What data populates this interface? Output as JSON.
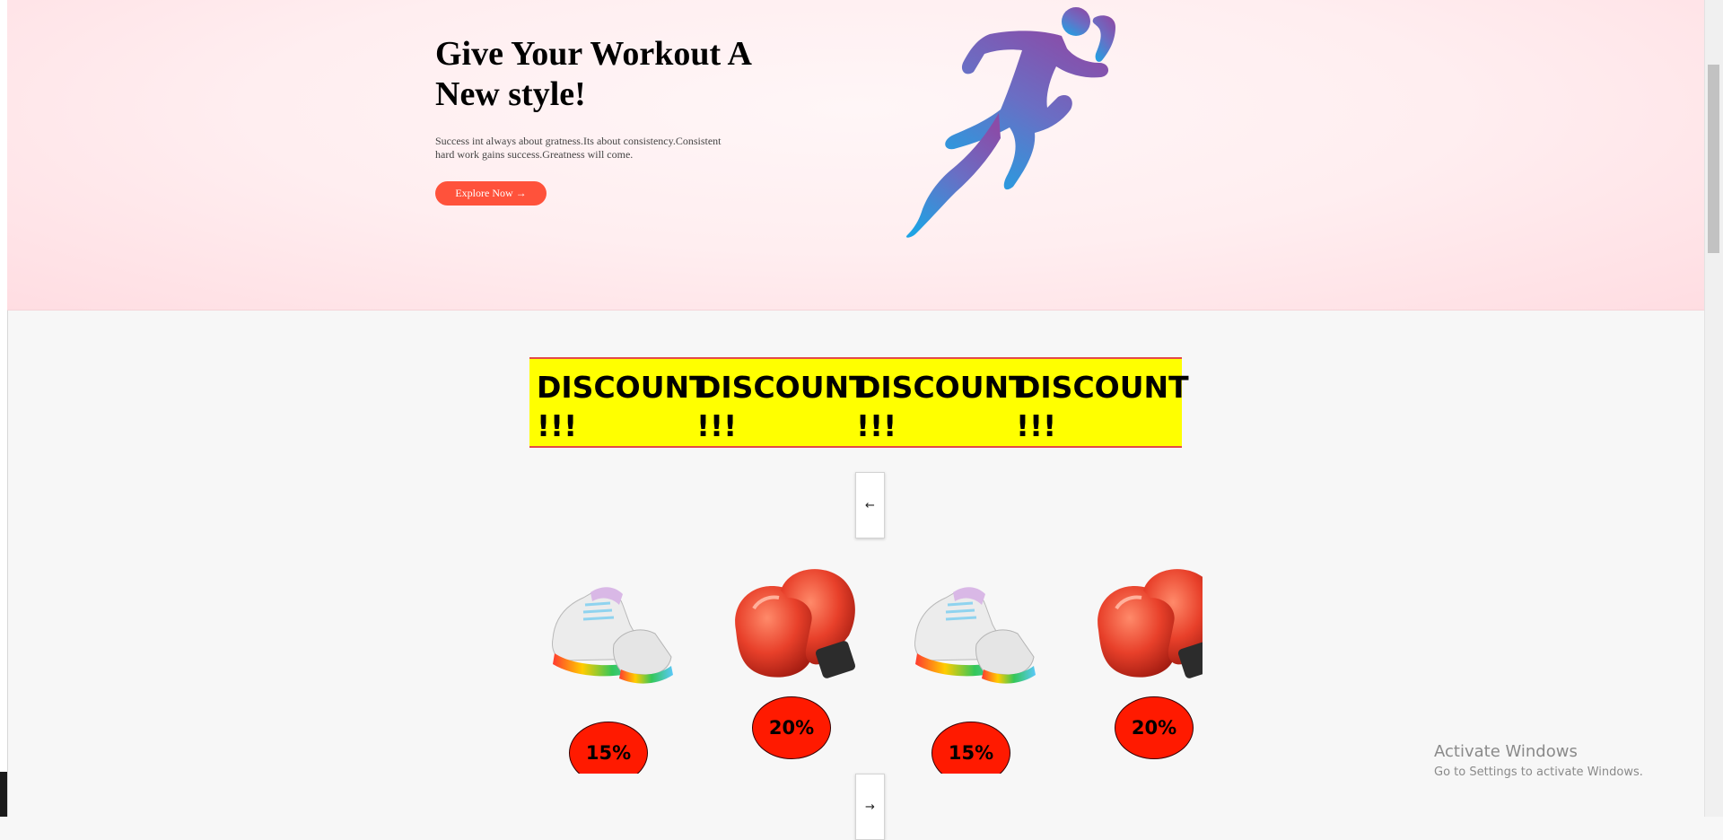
{
  "hero": {
    "title": "Give Your Workout A New style!",
    "subtitle": "Success int always about gratness.Its about consistency.Consistent hard work gains success.Greatness will come.",
    "button_label": "Explore Now →",
    "accent_color": "#ff523b",
    "illustration": "running-man-icon"
  },
  "discount_banner": {
    "items": [
      "DISCOUNT\n!!!",
      "DISCOUNT\n!!!",
      "DISCOUNT\n!!!",
      "DISCOUNT\n!!!"
    ],
    "background_color": "#ffff00"
  },
  "carousel": {
    "prev_label": "←",
    "next_label": "→",
    "products": [
      {
        "image": "running-shoes-icon",
        "discount": "15%"
      },
      {
        "image": "boxing-gloves-icon",
        "discount": "20%"
      },
      {
        "image": "running-shoes-icon",
        "discount": "15%"
      },
      {
        "image": "boxing-gloves-icon",
        "discount": "20%"
      }
    ]
  },
  "watermark": {
    "title": "Activate Windows",
    "subtitle": "Go to Settings to activate Windows."
  }
}
